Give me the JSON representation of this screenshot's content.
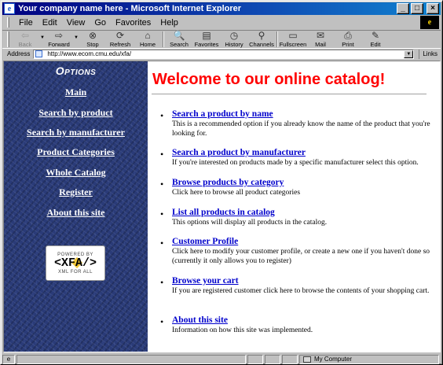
{
  "window": {
    "title": "Your company name here - Microsoft Internet Explorer",
    "app_icon": "ie-icon",
    "controls": {
      "minimize": "_",
      "maximize": "□",
      "close": "×"
    }
  },
  "menubar": {
    "items": [
      {
        "label": "File"
      },
      {
        "label": "Edit"
      },
      {
        "label": "View"
      },
      {
        "label": "Go"
      },
      {
        "label": "Favorites"
      },
      {
        "label": "Help"
      }
    ]
  },
  "toolbar": {
    "buttons": [
      {
        "label": "Back",
        "icon": "back-arrow-icon",
        "glyph": "⇦",
        "enabled": false
      },
      {
        "label": "Forward",
        "icon": "forward-arrow-icon",
        "glyph": "⇨",
        "enabled": true
      },
      {
        "label": "Stop",
        "icon": "stop-icon",
        "glyph": "⊗",
        "enabled": true
      },
      {
        "label": "Refresh",
        "icon": "refresh-icon",
        "glyph": "⟳",
        "enabled": true
      },
      {
        "label": "Home",
        "icon": "home-icon",
        "glyph": "⌂",
        "enabled": true
      },
      {
        "label": "Search",
        "icon": "search-icon",
        "glyph": "🔍",
        "enabled": true
      },
      {
        "label": "Favorites",
        "icon": "favorites-icon",
        "glyph": "▤",
        "enabled": true
      },
      {
        "label": "History",
        "icon": "history-icon",
        "glyph": "◷",
        "enabled": true
      },
      {
        "label": "Channels",
        "icon": "channels-icon",
        "glyph": "⚲",
        "enabled": true
      },
      {
        "label": "Fullscreen",
        "icon": "fullscreen-icon",
        "glyph": "▭",
        "enabled": true
      },
      {
        "label": "Mail",
        "icon": "mail-icon",
        "glyph": "✉",
        "enabled": true
      },
      {
        "label": "Print",
        "icon": "print-icon",
        "glyph": "⎙",
        "enabled": true
      },
      {
        "label": "Edit",
        "icon": "edit-icon",
        "glyph": "✎",
        "enabled": true
      }
    ]
  },
  "address": {
    "label": "Address",
    "url": "http://www.ecom.cmu.edu/xfa/",
    "links_label": "Links"
  },
  "sidebar": {
    "title": "Options",
    "links": [
      {
        "label": "Main"
      },
      {
        "label": "Search by product"
      },
      {
        "label": "Search by manufacturer"
      },
      {
        "label": "Product Categories"
      },
      {
        "label": "Whole Catalog"
      },
      {
        "label": "Register"
      },
      {
        "label": "About this site"
      }
    ],
    "badge": {
      "top": "POWERED BY",
      "main": "<XFA/>",
      "bottom": "XML FOR ALL"
    }
  },
  "content": {
    "heading": "Welcome to our online catalog!",
    "options": [
      {
        "link": "Search a product by name",
        "desc": "This is a recommended option if you already know the name of the product that you're looking for."
      },
      {
        "link": "Search a product by manufacturer",
        "desc": "If you're interested on products made by a specific manufacturer select this option."
      },
      {
        "link": "Browse products by category",
        "desc": "Click here to browse all product categories"
      },
      {
        "link": "List all products in catalog",
        "desc": "This options will display all products in the catalog."
      },
      {
        "link": "Customer Profile",
        "desc": "Click here to modify your customer profile, or create a new one if you haven't done so (currently it only allows you to register)"
      },
      {
        "link": "Browse your cart",
        "desc": "If you are registered customer click here to browse the contents of your shopping cart."
      },
      {
        "link": "About this site",
        "desc": "Information on how this site was implemented."
      }
    ]
  },
  "statusbar": {
    "zone": "My Computer"
  }
}
